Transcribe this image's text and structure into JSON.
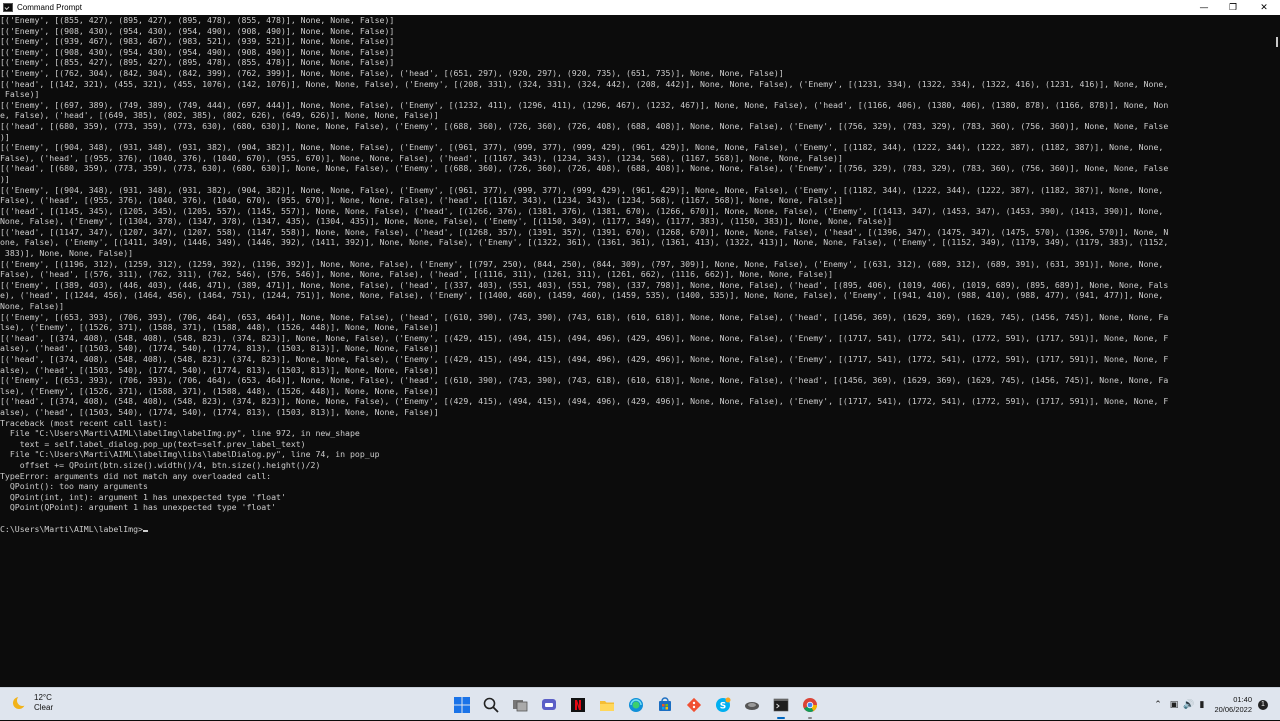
{
  "window": {
    "title": "Command Prompt",
    "controls": [
      "—",
      "❐",
      "✕"
    ]
  },
  "console": {
    "lines": [
      "[('Enemy', [(855, 427), (895, 427), (895, 478), (855, 478)], None, None, False)]",
      "[('Enemy', [(908, 430), (954, 430), (954, 490), (908, 490)], None, None, False)]",
      "[('Enemy', [(939, 467), (983, 467), (983, 521), (939, 521)], None, None, False)]",
      "[('Enemy', [(908, 430), (954, 430), (954, 490), (908, 490)], None, None, False)]",
      "[('Enemy', [(855, 427), (895, 427), (895, 478), (855, 478)], None, None, False)]",
      "[('Enemy', [(762, 304), (842, 304), (842, 399), (762, 399)], None, None, False), ('head', [(651, 297), (920, 297), (920, 735), (651, 735)], None, None, False)]",
      "[('head', [(142, 321), (455, 321), (455, 1076), (142, 1076)], None, None, False), ('Enemy', [(208, 331), (324, 331), (324, 442), (208, 442)], None, None, False), ('Enemy', [(1231, 334), (1322, 334), (1322, 416), (1231, 416)], None, None,",
      " False)]",
      "[('Enemy', [(697, 389), (749, 389), (749, 444), (697, 444)], None, None, False), ('Enemy', [(1232, 411), (1296, 411), (1296, 467), (1232, 467)], None, None, False), ('head', [(1166, 406), (1380, 406), (1380, 878), (1166, 878)], None, Non",
      "e, False), ('head', [(649, 385), (802, 385), (802, 626), (649, 626)], None, None, False)]",
      "[('head', [(680, 359), (773, 359), (773, 630), (680, 630)], None, None, False), ('Enemy', [(688, 360), (726, 360), (726, 408), (688, 408)], None, None, False), ('Enemy', [(756, 329), (783, 329), (783, 360), (756, 360)], None, None, False",
      ")]",
      "[('Enemy', [(904, 348), (931, 348), (931, 382), (904, 382)], None, None, False), ('Enemy', [(961, 377), (999, 377), (999, 429), (961, 429)], None, None, False), ('Enemy', [(1182, 344), (1222, 344), (1222, 387), (1182, 387)], None, None,",
      "False), ('head', [(955, 376), (1040, 376), (1040, 670), (955, 670)], None, None, False), ('head', [(1167, 343), (1234, 343), (1234, 568), (1167, 568)], None, None, False)]",
      "[('head', [(680, 359), (773, 359), (773, 630), (680, 630)], None, None, False), ('Enemy', [(688, 360), (726, 360), (726, 408), (688, 408)], None, None, False), ('Enemy', [(756, 329), (783, 329), (783, 360), (756, 360)], None, None, False",
      ")]",
      "[('Enemy', [(904, 348), (931, 348), (931, 382), (904, 382)], None, None, False), ('Enemy', [(961, 377), (999, 377), (999, 429), (961, 429)], None, None, False), ('Enemy', [(1182, 344), (1222, 344), (1222, 387), (1182, 387)], None, None,",
      "False), ('head', [(955, 376), (1040, 376), (1040, 670), (955, 670)], None, None, False), ('head', [(1167, 343), (1234, 343), (1234, 568), (1167, 568)], None, None, False)]",
      "[('head', [(1145, 345), (1205, 345), (1205, 557), (1145, 557)], None, None, False), ('head', [(1266, 376), (1381, 376), (1381, 670), (1266, 670)], None, None, False), ('Enemy', [(1413, 347), (1453, 347), (1453, 390), (1413, 390)], None,",
      "None, False), ('Enemy', [(1304, 378), (1347, 378), (1347, 435), (1304, 435)], None, None, False), ('Enemy', [(1150, 349), (1177, 349), (1177, 383), (1150, 383)], None, None, False)]",
      "[('head', [(1147, 347), (1207, 347), (1207, 558), (1147, 558)], None, None, False), ('head', [(1268, 357), (1391, 357), (1391, 670), (1268, 670)], None, None, False), ('head', [(1396, 347), (1475, 347), (1475, 570), (1396, 570)], None, N",
      "one, False), ('Enemy', [(1411, 349), (1446, 349), (1446, 392), (1411, 392)], None, None, False), ('Enemy', [(1322, 361), (1361, 361), (1361, 413), (1322, 413)], None, None, False), ('Enemy', [(1152, 349), (1179, 349), (1179, 383), (1152,",
      " 383)], None, None, False)]",
      "[('Enemy', [(1196, 312), (1259, 312), (1259, 392), (1196, 392)], None, None, False), ('Enemy', [(797, 250), (844, 250), (844, 309), (797, 309)], None, None, False), ('Enemy', [(631, 312), (689, 312), (689, 391), (631, 391)], None, None,",
      "False), ('head', [(576, 311), (762, 311), (762, 546), (576, 546)], None, None, False), ('head', [(1116, 311), (1261, 311), (1261, 662), (1116, 662)], None, None, False)]",
      "[('Enemy', [(389, 403), (446, 403), (446, 471), (389, 471)], None, None, False), ('head', [(337, 403), (551, 403), (551, 798), (337, 798)], None, None, False), ('head', [(895, 406), (1019, 406), (1019, 689), (895, 689)], None, None, Fals",
      "e), ('head', [(1244, 456), (1464, 456), (1464, 751), (1244, 751)], None, None, False), ('Enemy', [(1400, 460), (1459, 460), (1459, 535), (1400, 535)], None, None, False), ('Enemy', [(941, 410), (988, 410), (988, 477), (941, 477)], None,",
      "None, False)]",
      "[('Enemy', [(653, 393), (706, 393), (706, 464), (653, 464)], None, None, False), ('head', [(610, 390), (743, 390), (743, 618), (610, 618)], None, None, False), ('head', [(1456, 369), (1629, 369), (1629, 745), (1456, 745)], None, None, Fa",
      "lse), ('Enemy', [(1526, 371), (1588, 371), (1588, 448), (1526, 448)], None, None, False)]",
      "[('head', [(374, 408), (548, 408), (548, 823), (374, 823)], None, None, False), ('Enemy', [(429, 415), (494, 415), (494, 496), (429, 496)], None, None, False), ('Enemy', [(1717, 541), (1772, 541), (1772, 591), (1717, 591)], None, None, F",
      "alse), ('head', [(1503, 540), (1774, 540), (1774, 813), (1503, 813)], None, None, False)]",
      "[('head', [(374, 408), (548, 408), (548, 823), (374, 823)], None, None, False), ('Enemy', [(429, 415), (494, 415), (494, 496), (429, 496)], None, None, False), ('Enemy', [(1717, 541), (1772, 541), (1772, 591), (1717, 591)], None, None, F",
      "alse), ('head', [(1503, 540), (1774, 540), (1774, 813), (1503, 813)], None, None, False)]",
      "[('Enemy', [(653, 393), (706, 393), (706, 464), (653, 464)], None, None, False), ('head', [(610, 390), (743, 390), (743, 618), (610, 618)], None, None, False), ('head', [(1456, 369), (1629, 369), (1629, 745), (1456, 745)], None, None, Fa",
      "lse), ('Enemy', [(1526, 371), (1588, 371), (1588, 448), (1526, 448)], None, None, False)]",
      "[('head', [(374, 408), (548, 408), (548, 823), (374, 823)], None, None, False), ('Enemy', [(429, 415), (494, 415), (494, 496), (429, 496)], None, None, False), ('Enemy', [(1717, 541), (1772, 541), (1772, 591), (1717, 591)], None, None, F",
      "alse), ('head', [(1503, 540), (1774, 540), (1774, 813), (1503, 813)], None, None, False)]",
      "Traceback (most recent call last):",
      "  File \"C:\\Users\\Marti\\AIML\\labelImg\\labelImg.py\", line 972, in new_shape",
      "    text = self.label_dialog.pop_up(text=self.prev_label_text)",
      "  File \"C:\\Users\\Marti\\AIML\\labelImg\\libs\\labelDialog.py\", line 74, in pop_up",
      "    offset += QPoint(btn.size().width()/4, btn.size().height()/2)",
      "TypeError: arguments did not match any overloaded call:",
      "  QPoint(): too many arguments",
      "  QPoint(int, int): argument 1 has unexpected type 'float'",
      "  QPoint(QPoint): argument 1 has unexpected type 'float'",
      "",
      "C:\\Users\\Marti\\AIML\\labelImg>"
    ]
  },
  "taskbar": {
    "weather": {
      "temp": "12°C",
      "condition": "Clear"
    },
    "icons": [
      "start-icon",
      "search-icon",
      "task-view-icon",
      "chat-icon",
      "netflix-icon",
      "file-explorer-icon",
      "edge-icon",
      "microsoft-store-icon",
      "git-icon",
      "skype-icon",
      "logitech-icon",
      "terminal-icon",
      "chrome-icon"
    ],
    "clock": {
      "time": "01:40",
      "date": "20/06/2022"
    },
    "notifications": "1"
  }
}
